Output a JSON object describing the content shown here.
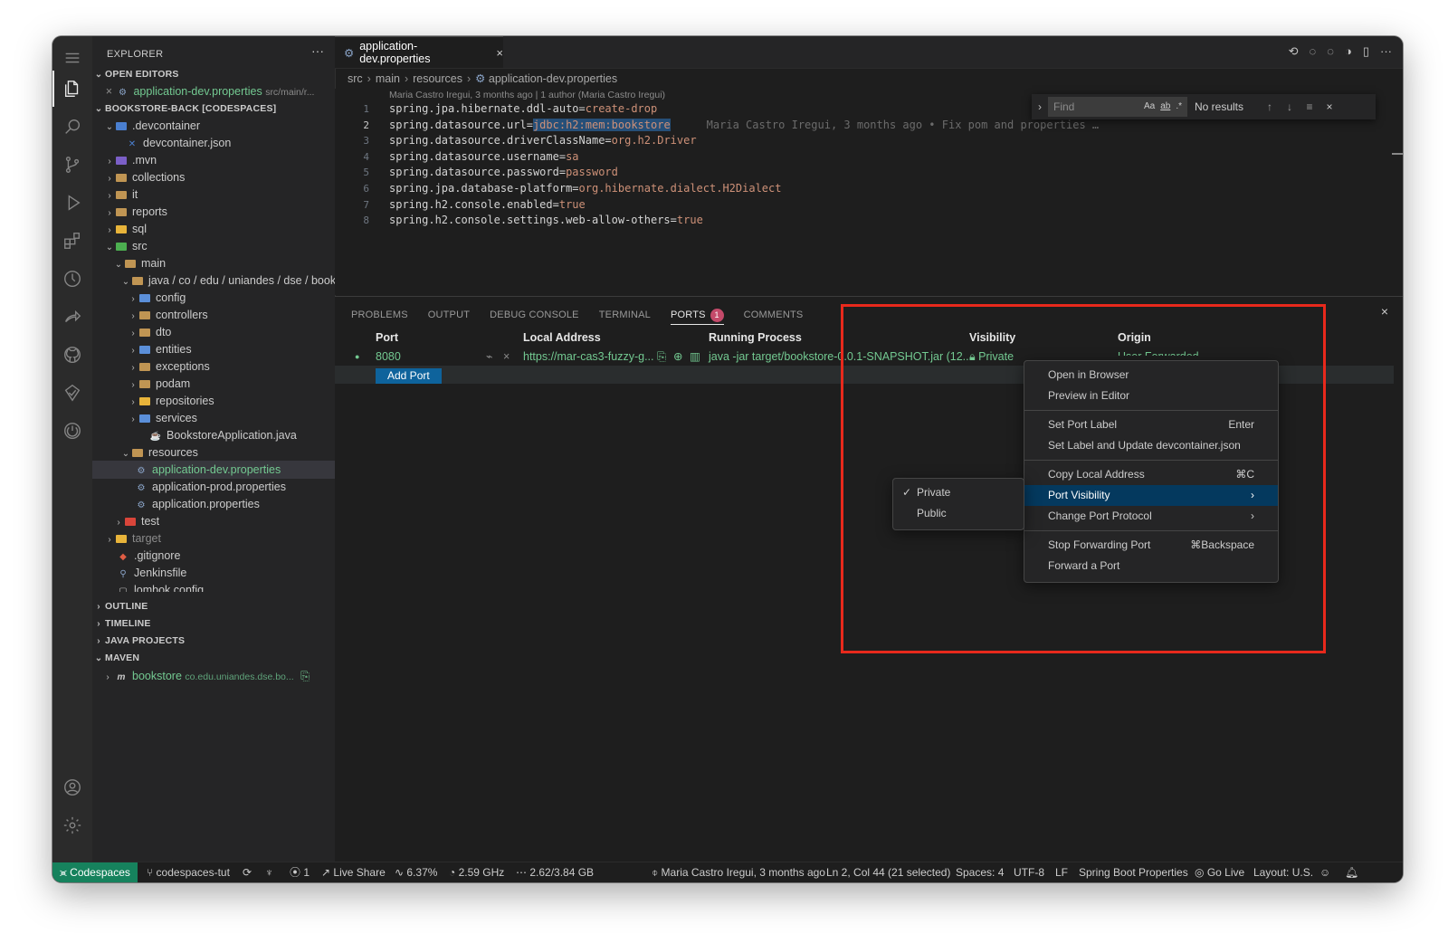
{
  "sidebar": {
    "title": "EXPLORER",
    "open_editors_label": "OPEN EDITORS",
    "open_editor": {
      "name": "application-dev.properties",
      "path": "src/main/r..."
    },
    "workspace_label": "BOOKSTORE-BACK [CODESPACES]",
    "tree": [
      "devcontainer",
      ".devcontainer",
      "devcontainer.json",
      ".mvn",
      "collections",
      "it",
      "reports",
      "sql",
      "src",
      "main",
      "java / co / edu / uniandes / dse / books...",
      "config",
      "controllers",
      "dto",
      "entities",
      "exceptions",
      "podam",
      "repositories",
      "services",
      "BookstoreApplication.java",
      "resources",
      "application-dev.properties",
      "application-prod.properties",
      "application.properties",
      "test",
      "target",
      ".gitignore",
      "Jenkinsfile",
      "lombok.config"
    ],
    "sections": {
      "outline": "OUTLINE",
      "timeline": "TIMELINE",
      "java_projects": "JAVA PROJECTS",
      "maven": "MAVEN"
    },
    "maven_item": {
      "name": "bookstore",
      "detail": "co.edu.uniandes.dse.bo..."
    }
  },
  "editor": {
    "tab_label": "application-dev.properties",
    "breadcrumb": [
      "src",
      "main",
      "resources",
      "application-dev.properties"
    ],
    "codelens": "Maria Castro Iregui, 3 months ago | 1 author (Maria Castro Iregui)",
    "blame": "Maria Castro Iregui, 3 months ago • Fix pom and properties …",
    "lines": [
      {
        "n": "1",
        "key": "spring.jpa.hibernate.ddl-auto=",
        "val": "create-drop"
      },
      {
        "n": "2",
        "key": "spring.datasource.url=",
        "val": "jdbc:h2:mem:bookstore"
      },
      {
        "n": "3",
        "key": "spring.datasource.driverClassName=",
        "val": "org.h2.Driver"
      },
      {
        "n": "4",
        "key": "spring.datasource.username=",
        "val": "sa"
      },
      {
        "n": "5",
        "key": "spring.datasource.password=",
        "val": "password"
      },
      {
        "n": "6",
        "key": "spring.jpa.database-platform=",
        "val": "org.hibernate.dialect.H2Dialect"
      },
      {
        "n": "7",
        "key": "spring.h2.console.enabled=",
        "val": "true"
      },
      {
        "n": "8",
        "key": "spring.h2.console.settings.web-allow-others=",
        "val": "true"
      }
    ],
    "find": {
      "placeholder": "Find",
      "case": "Aa",
      "word": "ab",
      "regex": ".*",
      "results": "No results"
    }
  },
  "panel": {
    "tabs": [
      "PROBLEMS",
      "OUTPUT",
      "DEBUG CONSOLE",
      "TERMINAL",
      "PORTS",
      "COMMENTS"
    ],
    "ports_badge": "1",
    "columns": {
      "port": "Port",
      "local_address": "Local Address",
      "running_process": "Running Process",
      "visibility": "Visibility",
      "origin": "Origin"
    },
    "row": {
      "port": "8080",
      "local_address": "https://mar-cas3-fuzzy-g...",
      "running_process": "java -jar target/bookstore-0.0.1-SNAPSHOT.jar (12...",
      "visibility": "Private",
      "origin": "User Forwarded"
    },
    "add_port": "Add Port"
  },
  "context_menu": {
    "items": [
      {
        "label": "Open in Browser",
        "shortcut": ""
      },
      {
        "label": "Preview in Editor",
        "shortcut": ""
      },
      {
        "label": "Set Port Label",
        "shortcut": "Enter"
      },
      {
        "label": "Set Label and Update devcontainer.json",
        "shortcut": ""
      },
      {
        "label": "Copy Local Address",
        "shortcut": "⌘C"
      },
      {
        "label": "Port Visibility",
        "shortcut": "›"
      },
      {
        "label": "Change Port Protocol",
        "shortcut": "›"
      },
      {
        "label": "Stop Forwarding Port",
        "shortcut": "⌘Backspace"
      },
      {
        "label": "Forward a Port",
        "shortcut": ""
      }
    ],
    "submenu": {
      "private": "Private",
      "public": "Public",
      "check": "✓"
    }
  },
  "statusbar": {
    "remote": "Codespaces",
    "branch": "codespaces-tut",
    "ports": "1",
    "live_share": "Live Share",
    "cpu": "6.37%",
    "freq": "2.59 GHz",
    "mem": "2.62/3.84 GB",
    "blame": "Maria Castro Iregui, 3 months ago",
    "cursor": "Ln 2, Col 44 (21 selected)",
    "spaces": "Spaces: 4",
    "encoding": "UTF-8",
    "eol": "LF",
    "language": "Spring Boot Properties",
    "go_live": "Go Live",
    "layout": "Layout: U.S."
  },
  "colors": {
    "accent": "#16825d",
    "highlight_box": "#e8291c",
    "menu_highlight": "#04395e"
  }
}
